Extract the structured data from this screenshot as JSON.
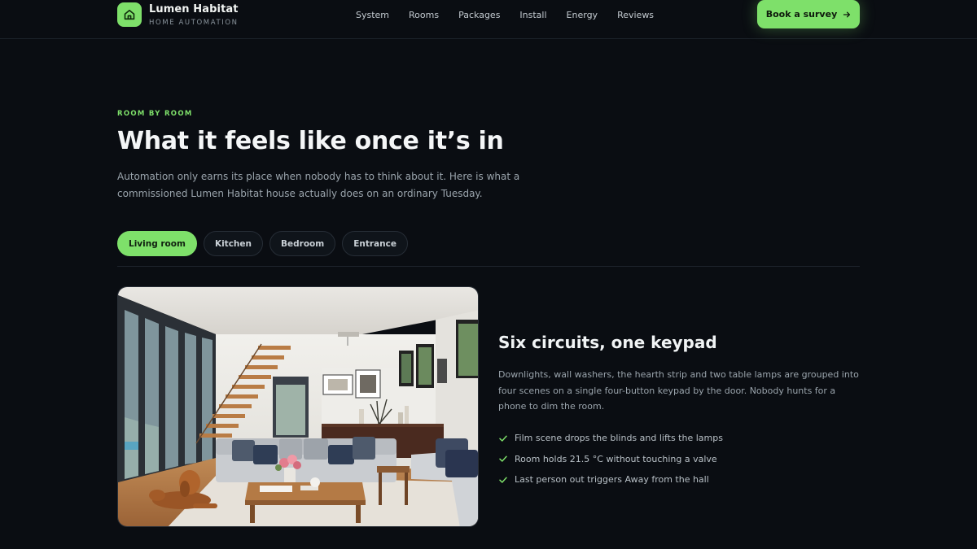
{
  "brand": {
    "name": "Lumen Habitat",
    "tagline": "HOME AUTOMATION",
    "logo_icon": "home-icon",
    "accent": "#7ee06a"
  },
  "nav": {
    "links": [
      "System",
      "Rooms",
      "Packages",
      "Install",
      "Energy",
      "Reviews"
    ],
    "cta_label": "Book a survey",
    "cta_icon": "arrow-right-icon"
  },
  "hero": {
    "eyebrow": "ROOM BY ROOM",
    "title": "What it feels like once it’s in",
    "intro": "Automation only earns its place when nobody has to think about it. Here is what a commissioned Lumen Habitat house actually does on an ordinary Tuesday."
  },
  "tabs": {
    "items": [
      "Living room",
      "Kitchen",
      "Bedroom",
      "Entrance"
    ],
    "active": "Living room"
  },
  "room": {
    "title": "Six circuits, one keypad",
    "description": "Downlights, wall washers, the hearth strip and two table lamps are grouped into four scenes on a single four-button keypad by the door. Nobody hunts for a phone to dim the room.",
    "features": [
      "Film scene drops the blinds and lifts the lamps",
      "Room holds 21.5 °C without touching a valve",
      "Last person out triggers Away from the hall"
    ],
    "feature_icon": "check-icon"
  }
}
